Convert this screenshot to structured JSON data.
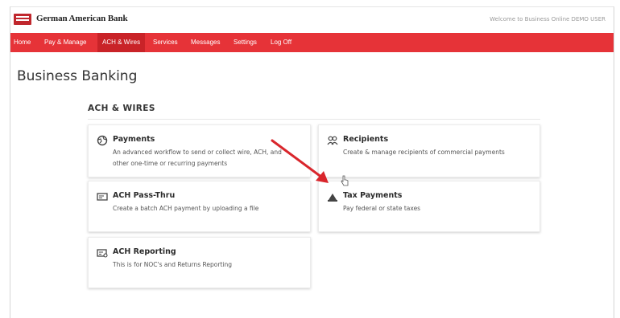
{
  "header": {
    "bank_name": "German American Bank",
    "welcome_text": "Welcome to Business Online DEMO USER"
  },
  "nav": {
    "items": [
      {
        "label": "Home"
      },
      {
        "label": "Pay & Manage"
      },
      {
        "label": "ACH & Wires",
        "active": true
      },
      {
        "label": "Services"
      },
      {
        "label": "Messages"
      },
      {
        "label": "Settings"
      },
      {
        "label": "Log Off"
      }
    ]
  },
  "page": {
    "title": "Business Banking",
    "section_title": "ACH & WIRES"
  },
  "cards": [
    {
      "title": "Payments",
      "description": "An advanced workflow to send or collect wire, ACH, and other one-time or recurring payments",
      "icon": "globe-money-icon"
    },
    {
      "title": "Recipients",
      "description": "Create & manage recipients of commercial payments",
      "icon": "people-icon"
    },
    {
      "title": "ACH Pass-Thru",
      "description": "Create a batch ACH payment by uploading a file",
      "icon": "upload-file-icon"
    },
    {
      "title": "Tax Payments",
      "description": "Pay federal or state taxes",
      "icon": "government-building-icon"
    },
    {
      "title": "ACH Reporting",
      "description": "This is for NOC's and Returns Reporting",
      "icon": "report-icon"
    }
  ],
  "colors": {
    "brand_red": "#e63338",
    "active_nav": "#c92328",
    "annotation_arrow": "#d9262c"
  }
}
